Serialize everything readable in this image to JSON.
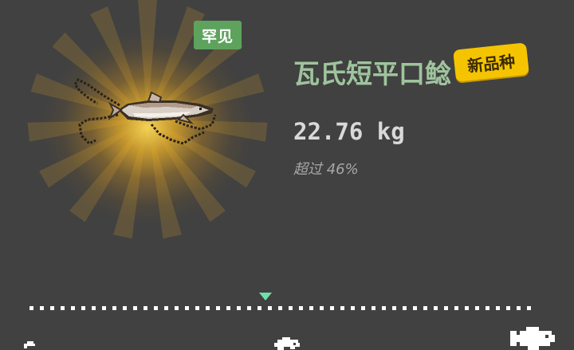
{
  "catch": {
    "rarity": "罕见",
    "fish_name": "瓦氏短平口鲶",
    "new_species_badge": "新品种",
    "weight": "22.76 kg",
    "percentile_text": "超过 46%"
  },
  "size_scale": {
    "position_fraction": 0.46,
    "marker_color": "#6fe0a8",
    "icons": [
      "small-fish-icon",
      "medium-fish-icon",
      "large-fish-icon"
    ]
  },
  "colors": {
    "background": "#414141",
    "rarity_badge": "#5da35d",
    "fish_name": "#9fc49d",
    "new_badge": "#f5c400",
    "glow": "#f0b428"
  }
}
